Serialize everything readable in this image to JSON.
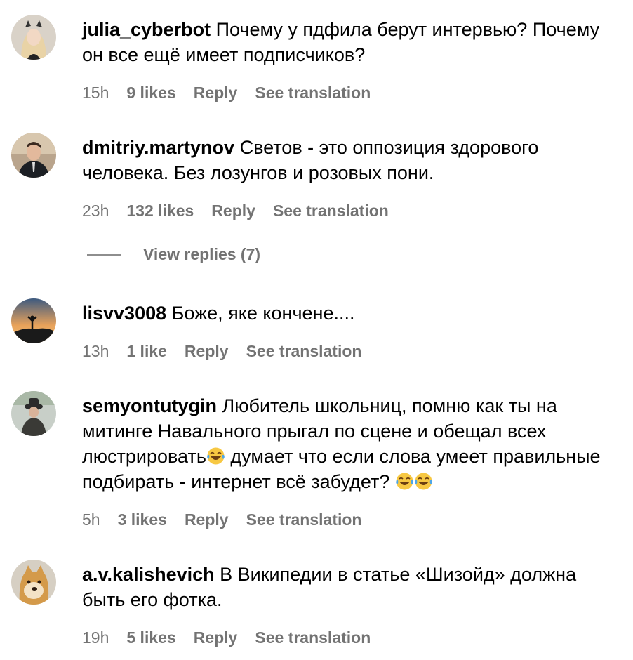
{
  "comments": [
    {
      "username": "julia_cyberbot",
      "text": "Почему у пдфила берут интервью? Почему он все ещё имеет подписчиков?",
      "time": "15h",
      "likes": "9 likes",
      "reply": "Reply",
      "translate": "See translation",
      "avatar": "avatar-girl"
    },
    {
      "username": "dmitriy.martynov",
      "text": "Светов - это оппозиция здорового человека. Без лозунгов и розовых пони.",
      "time": "23h",
      "likes": "132 likes",
      "reply": "Reply",
      "translate": "See translation",
      "avatar": "avatar-man-suit",
      "view_replies": "View replies (7)"
    },
    {
      "username": "lisvv3008",
      "text": "Боже, яке кончене....",
      "time": "13h",
      "likes": "1 like",
      "reply": "Reply",
      "translate": "See translation",
      "avatar": "avatar-sunset"
    },
    {
      "username": "semyontutygin",
      "text_parts": [
        "Любитель школьниц, помню как ты на митинге Навального прыгал по сцене и обещал всех люстрировать",
        " думает что если слова умеет правильные подбирать - интернет всё забудет? "
      ],
      "time": "5h",
      "likes": "3 likes",
      "reply": "Reply",
      "translate": "See translation",
      "avatar": "avatar-man-hat"
    },
    {
      "username": "a.v.kalishevich",
      "text": "В Википедии в статье «Шизойд» должна быть его фотка.",
      "time": "19h",
      "likes": "5 likes",
      "reply": "Reply",
      "translate": "See translation",
      "avatar": "avatar-doge"
    }
  ],
  "emoji": "face-with-tears-of-joy-emoji",
  "colors": {
    "meta": "#737373",
    "text": "#000000",
    "background": "#ffffff"
  }
}
